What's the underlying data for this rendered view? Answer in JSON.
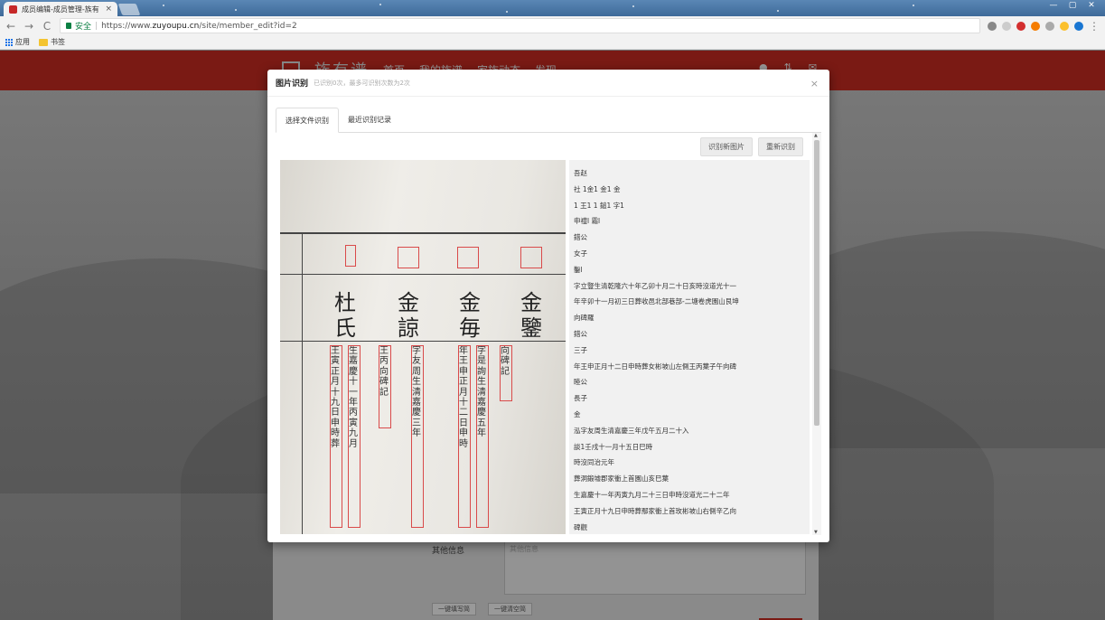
{
  "browser": {
    "tab_title": "成员编辑-成员管理-族有",
    "tab_close": "×",
    "window_controls": [
      "—",
      "▢",
      "✕"
    ],
    "nav": {
      "back": "←",
      "forward": "→",
      "reload": "C"
    },
    "secure_label": "安全",
    "url_prefix": "https://www.",
    "url_domain": "zuyoupu.cn",
    "url_path": "/site/member_edit?id=2",
    "bookmarks": [
      {
        "label": "应用",
        "icon": "apps-icon"
      },
      {
        "label": "书签",
        "icon": "folder-icon"
      }
    ]
  },
  "site": {
    "brand": "族有谱",
    "nav": [
      "首页",
      "我的族谱",
      "家族动态",
      "发现"
    ],
    "form_label": "其他信息",
    "form_placeholder": "其他信息",
    "form_buttons": [
      "一键填写简",
      "一键清空简"
    ]
  },
  "modal": {
    "title": "图片识别",
    "subtitle": "已识别0次，最多可识别次数为2次",
    "close": "×",
    "tabs": [
      "选择文件识别",
      "最近识别记录"
    ],
    "buttons": {
      "new": "识别新图片",
      "redo": "重新识别"
    }
  },
  "scan": {
    "big_chars": [
      "杜",
      "氏",
      "金",
      "諒",
      "金",
      "毎",
      "金",
      "鑒"
    ],
    "columns": [
      "王寅正月十九日申時葬",
      "生嘉慶十一年丙寅九月",
      "王丙向碑記",
      "字友周生清嘉慶三年",
      "年王申正月十二日申時",
      "字是詢生清嘉慶五年",
      "向碑記"
    ]
  },
  "ocr_lines": [
    "吾赵",
    "社 1金1 金1 金",
    "1 王1 1 鎚1 字1",
    "申禮l 霜l",
    "錯公",
    "女子",
    "鑿l",
    "字立豎生清乾隆六十年乙卯十月二十日亥時沒道光十一",
    "年辛卯十一月初三日葬收邑北部巷部-二塘卷虎園山艮坤",
    "向碑羅",
    "錯公",
    "三子",
    "年王申正月十二日申時葬女彬坡山左側王丙葉子午向碑",
    "睦公",
    "長子",
    "金",
    "泓字友周生清嘉慶三年戊午五月二十入",
    "談1壬戌十一月十五日巳時",
    "時沒同治元年",
    "葬洞鍛墟郡家衝上首園山亥巳葉",
    "生嘉慶十一年丙寅九月二十三日申時沒道光二十二年",
    "王寅正月十九日申時葬鄢家衝上首玫彬坡山右側辛乙向",
    "碑觀"
  ]
}
